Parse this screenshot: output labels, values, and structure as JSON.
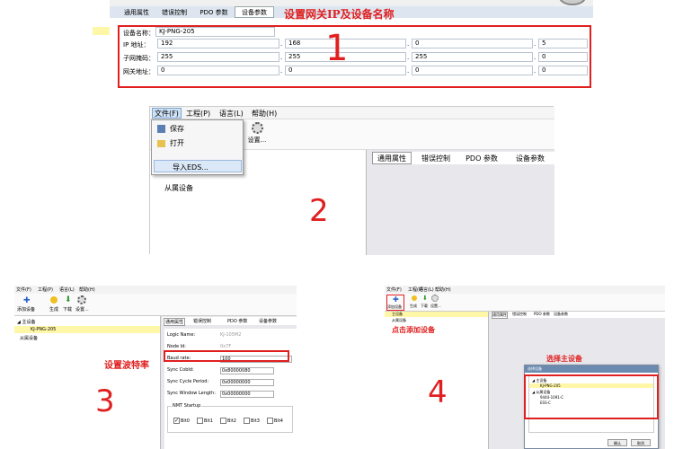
{
  "panel1": {
    "tabs": [
      "通用属性",
      "错误控制",
      "PDO 参数",
      "设备参数"
    ],
    "annotation": "设置网关IP及设备名称",
    "number": "1",
    "device_name_label": "设备名称：",
    "device_name_value": "KJ-PNG-205",
    "rows": [
      {
        "label": "IP 地址：",
        "values": [
          "192",
          "168",
          "0",
          "5"
        ]
      },
      {
        "label": "子网掩码：",
        "values": [
          "255",
          "255",
          "255",
          "0"
        ]
      },
      {
        "label": "网关地址：",
        "values": [
          "0",
          "0",
          "0",
          "0"
        ]
      }
    ]
  },
  "panel2": {
    "menubar": [
      "文件(F)",
      "工程(P)",
      "语言(L)",
      "帮助(H)"
    ],
    "menu_items": [
      "保存",
      "打开",
      "导入EDS..."
    ],
    "settings_label": "设置...",
    "tree_item": "从属设备",
    "tabs": [
      "通用属性",
      "错误控制",
      "PDO 参数",
      "设备参数"
    ],
    "number": "2"
  },
  "panel3": {
    "menubar": [
      "文件(F)",
      "工程(P)",
      "语言(L)",
      "帮助(H)"
    ],
    "toolbar": [
      "添加设备",
      "生成",
      "下载",
      "设置..."
    ],
    "tree": [
      "主设备",
      "KJ-PNG-205",
      "从属设备"
    ],
    "tabs": [
      "通用属性",
      "错误控制",
      "PDO 参数",
      "设备参数"
    ],
    "props": [
      {
        "label": "Logic Name:",
        "value": "KJ-105M2"
      },
      {
        "label": "Node Id:",
        "value": "0x7F"
      },
      {
        "label": "Baud rate:",
        "value": "100"
      },
      {
        "label": "Sync CobId:",
        "value": "0x80000080"
      },
      {
        "label": "Sync Cycle Period:",
        "value": "0x00000000"
      },
      {
        "label": "Sync Window Length:",
        "value": "0x00000000"
      }
    ],
    "nmt_label": "NMT Startup",
    "bits": [
      "Bit0",
      "Bit1",
      "Bit2",
      "Bit3",
      "Bit4"
    ],
    "annotation": "设置波特率",
    "number": "3"
  },
  "panel4": {
    "menubar": [
      "文件(F)",
      "工程(P)",
      "语言(L)",
      "帮助(H)"
    ],
    "toolbar": [
      "添加设备",
      "生成",
      "下载",
      "设置..."
    ],
    "tree": [
      "主设备",
      "从属设备"
    ],
    "tabs": [
      "通用属性",
      "错误控制",
      "PDO 参数",
      "设备参数"
    ],
    "annotation_add": "点击添加设备",
    "annotation_select": "选择主设备",
    "dialog_title": "选择设备",
    "dialog_tree": [
      "主设备",
      "KJ-PNG-205",
      "从属设备",
      "9444-1091-C",
      "ESS-C"
    ],
    "ok": "确认",
    "cancel": "取消",
    "number": "4"
  },
  "colors": {
    "red": "#e02020",
    "highlight": "#fff7a8",
    "tabbar": "#dde6f0",
    "panel": "#e8e8ec"
  }
}
